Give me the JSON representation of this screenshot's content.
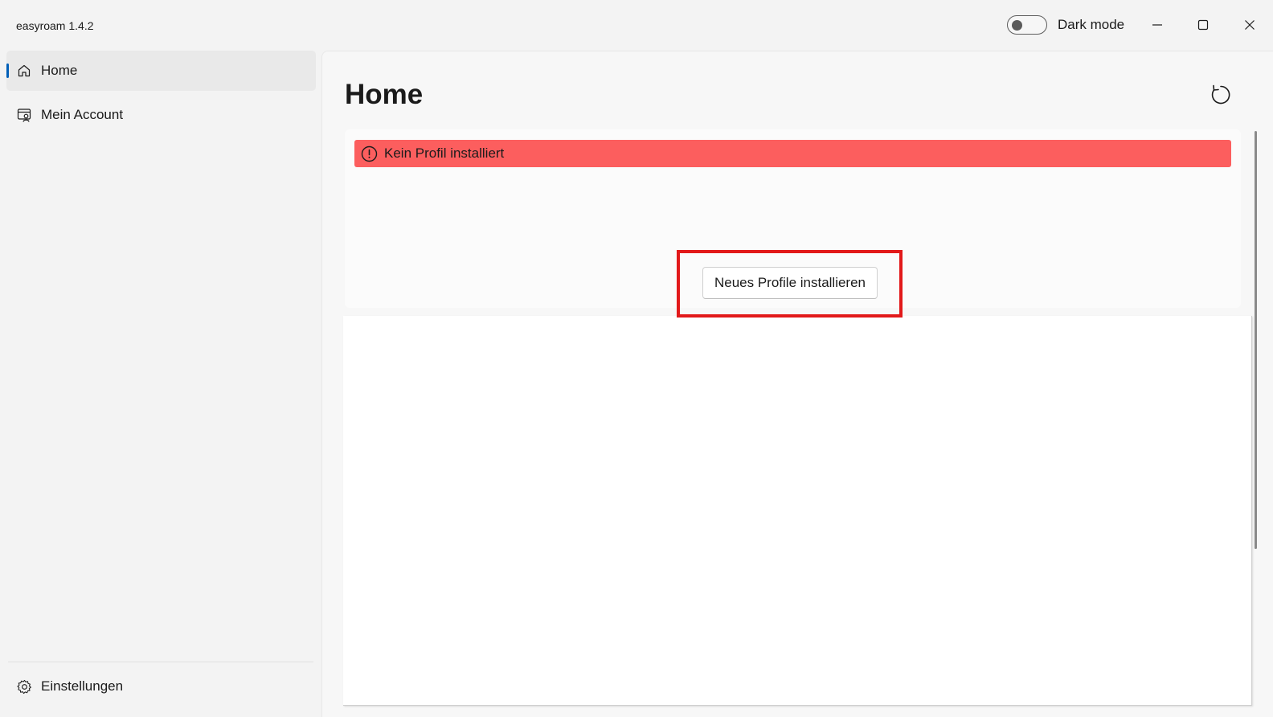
{
  "window": {
    "title": "easyroam 1.4.2",
    "dark_mode_label": "Dark mode",
    "dark_mode_on": false,
    "controls": [
      "minimize-icon",
      "maximize-icon",
      "close-icon"
    ]
  },
  "sidebar": {
    "items": [
      {
        "label": "Home",
        "icon": "home-icon",
        "active": true
      },
      {
        "label": "Mein Account",
        "icon": "account-icon",
        "active": false
      }
    ],
    "footer": {
      "label": "Einstellungen",
      "icon": "gear-icon"
    }
  },
  "main": {
    "title": "Home",
    "refresh_icon": "refresh-icon",
    "alert": {
      "text": "Kein Profil installiert",
      "icon": "alert-circle-icon",
      "color": "#fc5e5e"
    },
    "install_button_label": "Neues Profile installieren",
    "highlight_color": "#e2191a"
  },
  "colors": {
    "accent": "#005fb8",
    "background": "#f3f3f3"
  }
}
